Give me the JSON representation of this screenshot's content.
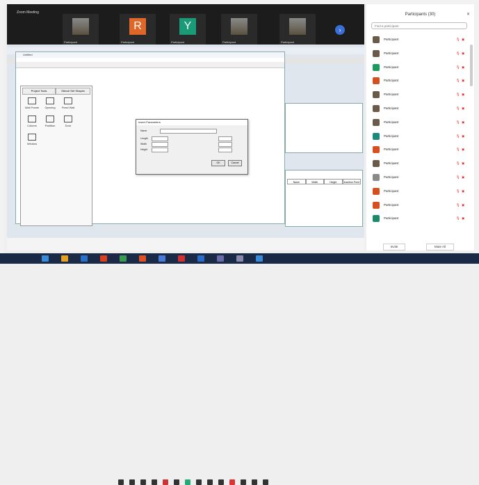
{
  "meeting": {
    "label": "Zoom Meeting",
    "tiles": [
      {
        "initial": "",
        "name": "Participant",
        "color": "#6a6a6a",
        "photo": true
      },
      {
        "initial": "R",
        "name": "Participant",
        "color": "#e0672a",
        "photo": false
      },
      {
        "initial": "Y",
        "name": "Participant",
        "color": "#1a9a77",
        "photo": false
      },
      {
        "initial": "",
        "name": "Participant",
        "color": "#6a6a6a",
        "photo": true
      },
      {
        "initial": "",
        "name": "Participant",
        "color": "#6a6a6a",
        "photo": true
      }
    ]
  },
  "app": {
    "title": "Untitled",
    "left_tabs": [
      "Project Tools",
      "Stencil Set Shapes"
    ],
    "tools": [
      "Wall Frame",
      "Opening",
      "Fixed Wall",
      "Column",
      "Partition",
      "Door",
      "Window"
    ],
    "dialog": {
      "title": "Insert Parameters",
      "name_label": "Name",
      "fields": [
        "Length",
        "Width",
        "Height"
      ],
      "ok": "OK",
      "cancel": "Cancel"
    },
    "table_headers": [
      "Name",
      "Width",
      "Height",
      "Insertion Point"
    ]
  },
  "participants": {
    "title": "Participants (30)",
    "search_placeholder": "Find a participant",
    "list": [
      {
        "name": "Participant",
        "color": "#6a5a4a"
      },
      {
        "name": "Participant",
        "color": "#6a5a4a"
      },
      {
        "name": "Participant",
        "color": "#1a9a60"
      },
      {
        "name": "Participant",
        "color": "#d45020"
      },
      {
        "name": "Participant",
        "color": "#6a5a4a"
      },
      {
        "name": "Participant",
        "color": "#6a5a4a"
      },
      {
        "name": "Participant",
        "color": "#6a5a4a"
      },
      {
        "name": "Participant",
        "color": "#1a8a7a"
      },
      {
        "name": "Participant",
        "color": "#d45020"
      },
      {
        "name": "Participant",
        "color": "#6a5a4a"
      },
      {
        "name": "Participant",
        "color": "#8a8a8a"
      },
      {
        "name": "Participant",
        "color": "#d45020"
      },
      {
        "name": "Participant",
        "color": "#d45020"
      },
      {
        "name": "Participant",
        "color": "#1a8a6a"
      }
    ],
    "invite": "Invite",
    "mute_all": "Mute All"
  }
}
